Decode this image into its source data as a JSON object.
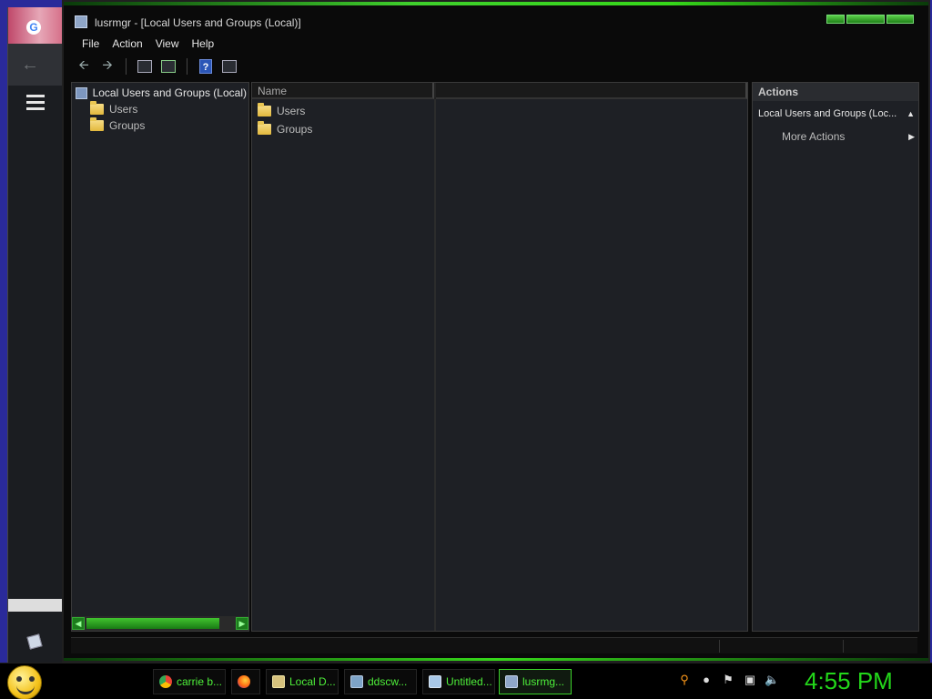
{
  "window": {
    "title": "lusrmgr - [Local Users and Groups (Local)]"
  },
  "menu": [
    "File",
    "Action",
    "View",
    "Help"
  ],
  "tree": {
    "root_label": "Local Users and Groups (Local)",
    "children": [
      "Users",
      "Groups"
    ]
  },
  "list": {
    "columns": [
      "Name",
      ""
    ],
    "rows": [
      "Users",
      "Groups"
    ]
  },
  "actions": {
    "header": "Actions",
    "group_label": "Local Users and Groups (Loc...",
    "more_actions": "More Actions"
  },
  "taskbar": {
    "items": [
      "carrie b...",
      "",
      "Local D...",
      "ddscw...",
      "Untitled...",
      "lusrmg..."
    ],
    "clock": "4:55 PM"
  },
  "icons": {
    "start": "smiley-icon",
    "tray": [
      "search-icon",
      "speech-icon",
      "flag-icon",
      "network-icon",
      "volume-icon"
    ]
  },
  "colors": {
    "accent": "#36d81a",
    "taskbar_text": "#4ef03a"
  }
}
